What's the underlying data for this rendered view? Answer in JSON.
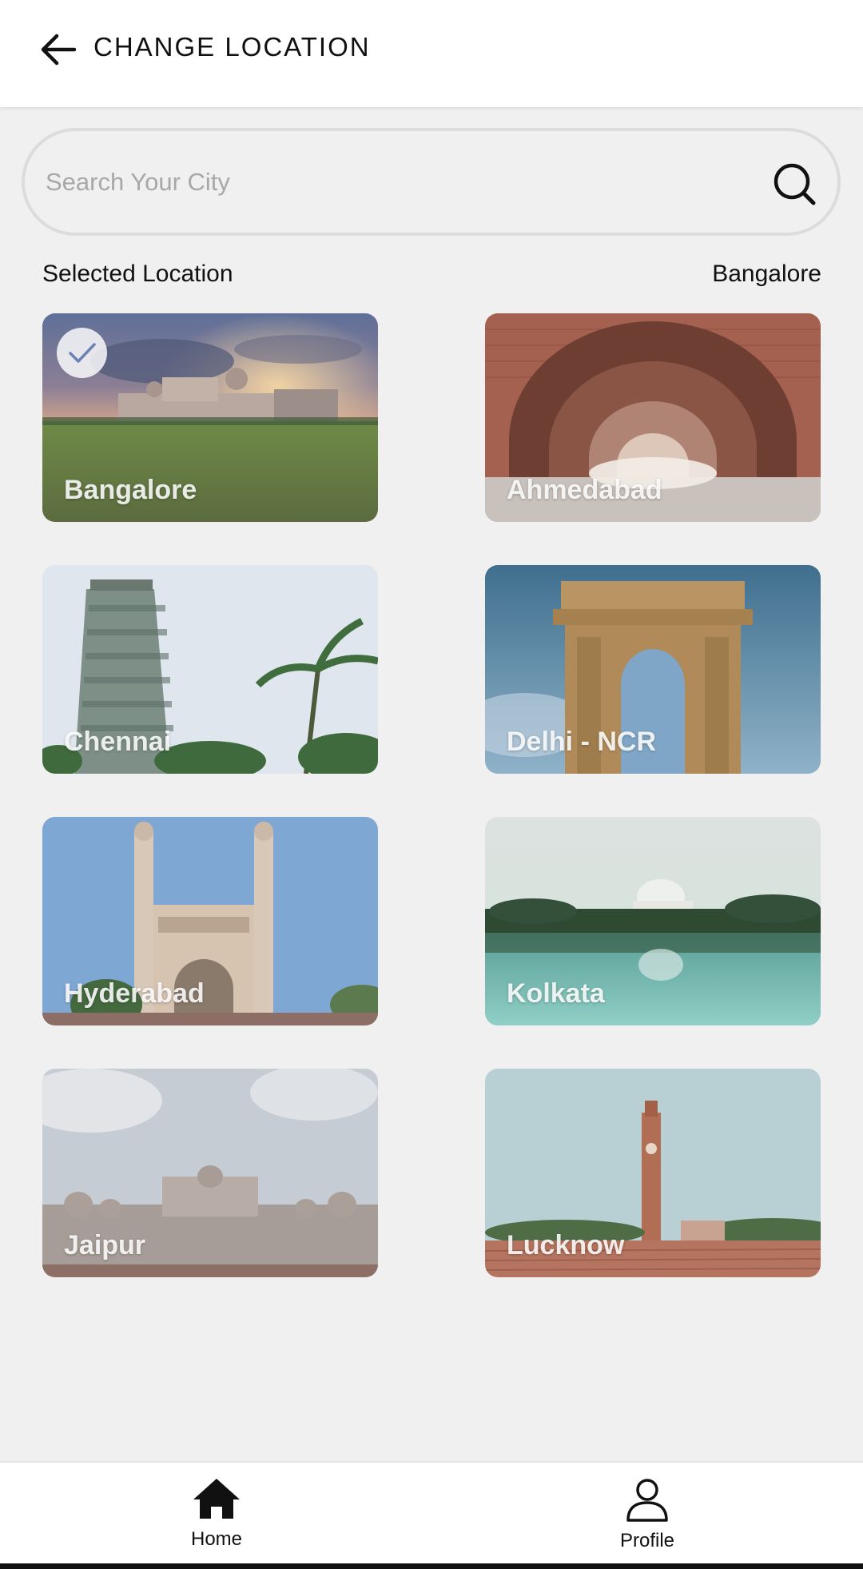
{
  "header": {
    "title": "CHANGE LOCATION",
    "back_icon": "arrow-left-icon"
  },
  "search": {
    "placeholder": "Search Your City",
    "value": "",
    "icon": "search-icon"
  },
  "selected": {
    "label": "Selected Location",
    "value": "Bangalore"
  },
  "cities": [
    {
      "name": "Bangalore",
      "selected": true
    },
    {
      "name": "Ahmedabad",
      "selected": false
    },
    {
      "name": "Chennai",
      "selected": false
    },
    {
      "name": "Delhi - NCR",
      "selected": false
    },
    {
      "name": "Hyderabad",
      "selected": false
    },
    {
      "name": "Kolkata",
      "selected": false
    },
    {
      "name": "Jaipur",
      "selected": false
    },
    {
      "name": "Lucknow",
      "selected": false
    }
  ],
  "nav": {
    "home_label": "Home",
    "home_icon": "home-icon",
    "profile_label": "Profile",
    "profile_icon": "profile-icon"
  },
  "colors": {
    "background": "#f0f0f0",
    "header": "#ffffff",
    "text": "#111111",
    "placeholder": "#a8a8a8"
  }
}
